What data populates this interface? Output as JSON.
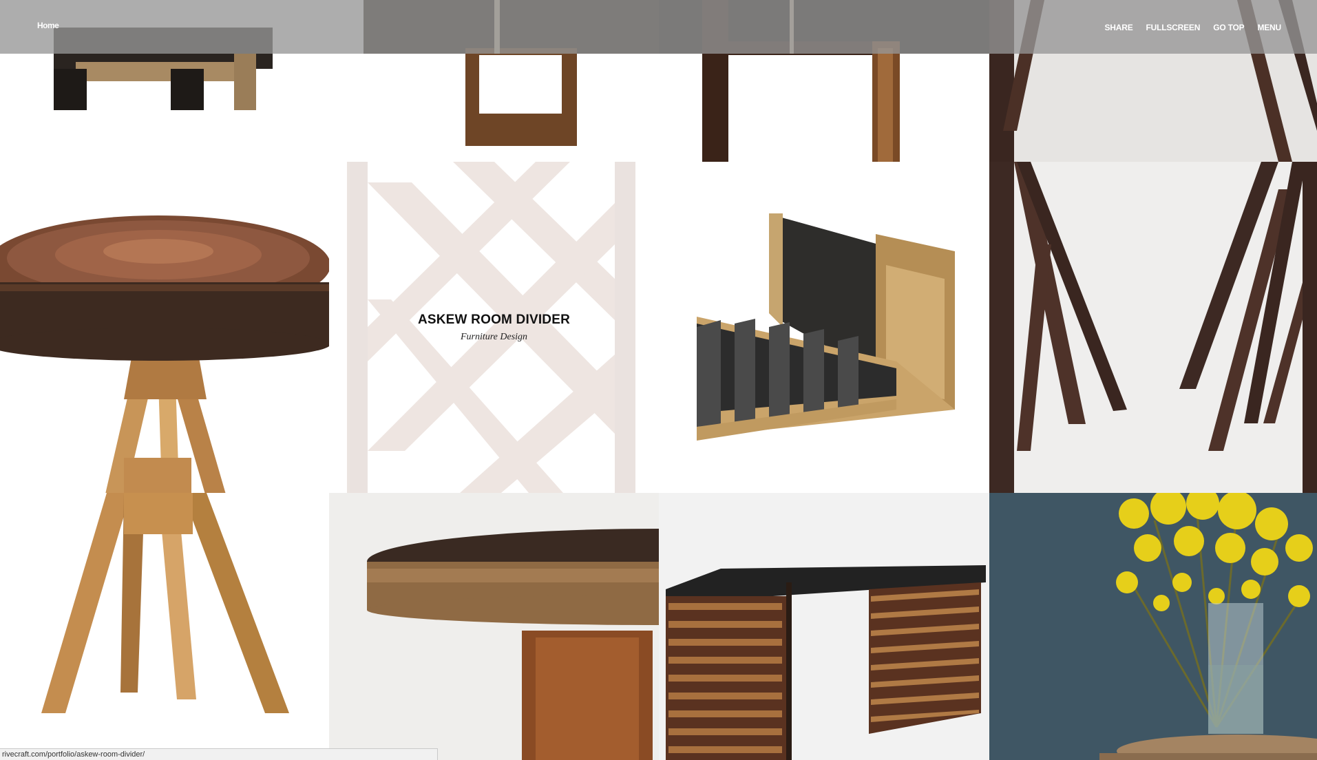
{
  "header": {
    "logo": "Home",
    "nav": {
      "share": "SHARE",
      "fullscreen": "FULLSCREEN",
      "go_top": "GO TOP",
      "menu": "MENU"
    }
  },
  "hover_overlay": {
    "title": "ASKEW ROOM DIVIDER",
    "subtitle": "Furniture Design"
  },
  "status_bar": {
    "url": "rivecraft.com/portfolio/askew-room-divider/"
  },
  "colors": {
    "header_bg": "#969696",
    "dark_wood": "#3e2a1e",
    "brass": "#c8955a",
    "slate_wall": "#3d5563",
    "forsythia": "#e8d21b"
  }
}
